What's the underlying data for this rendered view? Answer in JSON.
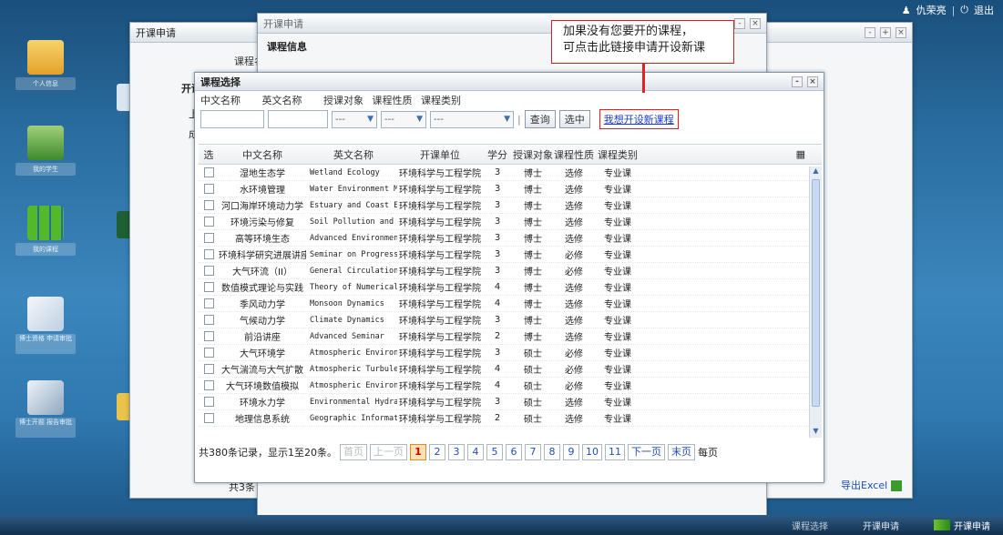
{
  "topbar": {
    "user": "仇荣亮",
    "logout": "退出"
  },
  "desktop": {
    "icons": [
      "个人信息",
      "我的学生",
      "我的课程",
      "博士资格\n申请审批",
      "博士开题\n报告审批"
    ]
  },
  "win_back": {
    "title": "开课申请",
    "tab": "课程名",
    "side_items": [
      "开课",
      "上",
      "成"
    ],
    "footer_total": "共3条",
    "export_label": "导出Excel"
  },
  "win_mid": {
    "title": "开课申请",
    "section": "课程信息"
  },
  "dialog": {
    "title": "课程选择",
    "filters": {
      "labels": [
        "中文名称",
        "英文名称",
        "授课对象",
        "课程性质",
        "课程类别"
      ],
      "select_placeholder": "---",
      "query_button": "查询",
      "select_button": "选中",
      "apply_link": "我想开设新课程"
    },
    "columns": [
      "选",
      "中文名称",
      "英文名称",
      "开课单位",
      "学分",
      "授课对象",
      "课程性质",
      "课程类别"
    ],
    "rows": [
      [
        "湿地生态学",
        "Wetland Ecology",
        "环境科学与工程学院",
        "3",
        "博士",
        "选修",
        "专业课"
      ],
      [
        "水环境管理",
        "Water Environment Ma",
        "环境科学与工程学院",
        "3",
        "博士",
        "选修",
        "专业课"
      ],
      [
        "河口海岸环境动力学",
        "Estuary and Coast En",
        "环境科学与工程学院",
        "3",
        "博士",
        "选修",
        "专业课"
      ],
      [
        "环境污染与修复",
        "Soil Pollution and R",
        "环境科学与工程学院",
        "3",
        "博士",
        "选修",
        "专业课"
      ],
      [
        "高等环境生态",
        "Advanced Environment",
        "环境科学与工程学院",
        "3",
        "博士",
        "选修",
        "专业课"
      ],
      [
        "环境科学研究进展讲座",
        "Seminar on Progress",
        "环境科学与工程学院",
        "3",
        "博士",
        "必修",
        "专业课"
      ],
      [
        "大气环流（II）",
        "General Circulation",
        "环境科学与工程学院",
        "3",
        "博士",
        "必修",
        "专业课"
      ],
      [
        "数值模式理论与实践",
        "Theory of Numerical",
        "环境科学与工程学院",
        "4",
        "博士",
        "选修",
        "专业课"
      ],
      [
        "季风动力学",
        "Monsoon Dynamics",
        "环境科学与工程学院",
        "4",
        "博士",
        "选修",
        "专业课"
      ],
      [
        "气候动力学",
        "Climate Dynamics",
        "环境科学与工程学院",
        "3",
        "博士",
        "选修",
        "专业课"
      ],
      [
        "前沿讲座",
        "Advanced Seminar",
        "环境科学与工程学院",
        "2",
        "博士",
        "选修",
        "专业课"
      ],
      [
        "大气环境学",
        "Atmospheric Environm",
        "环境科学与工程学院",
        "3",
        "硕士",
        "必修",
        "专业课"
      ],
      [
        "大气湍流与大气扩散",
        "Atmospheric Turbulen",
        "环境科学与工程学院",
        "4",
        "硕士",
        "必修",
        "专业课"
      ],
      [
        "大气环境数值模拟",
        "Atmospheric Environm",
        "环境科学与工程学院",
        "4",
        "硕士",
        "必修",
        "专业课"
      ],
      [
        "环境水力学",
        "Environmental Hydrau",
        "环境科学与工程学院",
        "3",
        "硕士",
        "选修",
        "专业课"
      ],
      [
        "地理信息系统",
        "Geographic Informati",
        "环境科学与工程学院",
        "2",
        "硕士",
        "选修",
        "专业课"
      ]
    ],
    "pager": {
      "summary": "共380条记录，显示1至20条。",
      "first": "首页",
      "prev": "上一页",
      "pages": [
        "1",
        "2",
        "3",
        "4",
        "5",
        "6",
        "7",
        "8",
        "9",
        "10",
        "11"
      ],
      "next": "下一页",
      "last": "末页",
      "per_page": "每页"
    }
  },
  "callout": {
    "line1": "加果没有您要开的课程，",
    "line2": "可点击此链接申请开设新课"
  },
  "taskbar": {
    "items": [
      "课程选择",
      "开课申请",
      "开课申请"
    ]
  }
}
